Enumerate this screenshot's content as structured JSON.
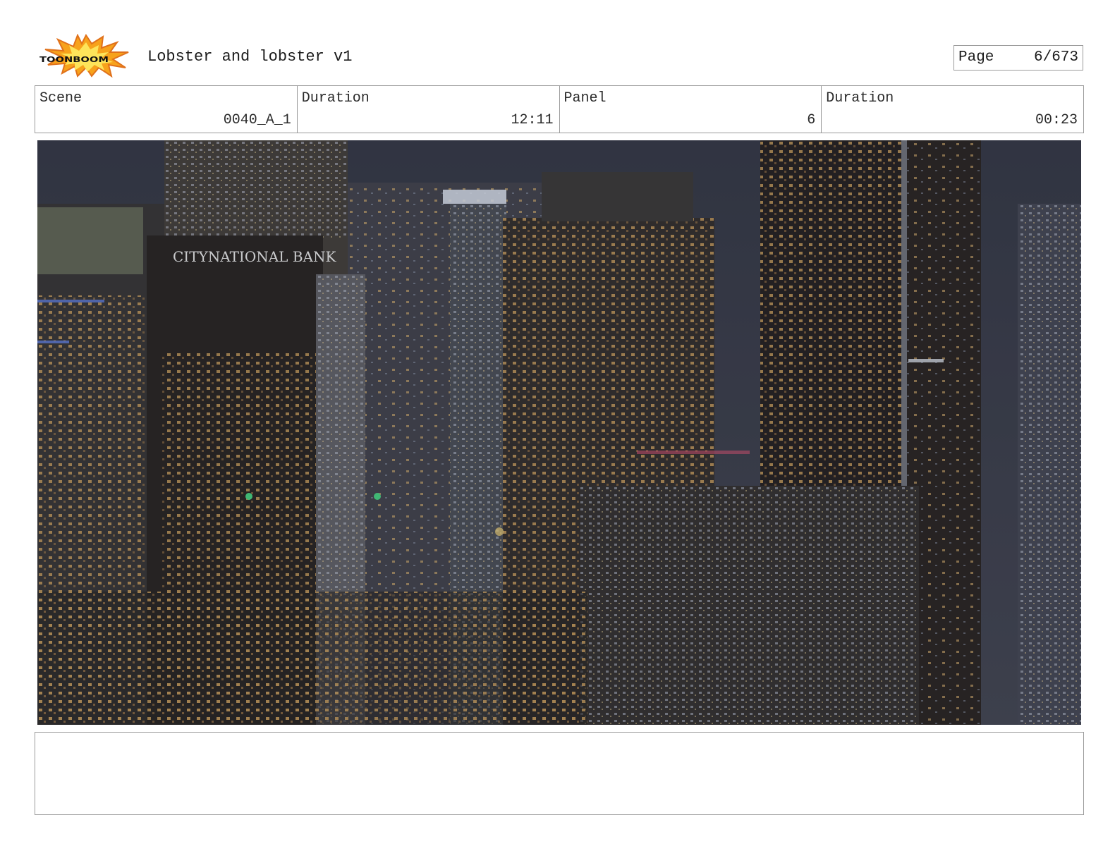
{
  "header": {
    "logo_text": "TOONBOOM",
    "title": "Lobster and lobster v1",
    "page_label": "Page",
    "page_value": "6/673"
  },
  "info": {
    "scene_label": "Scene",
    "scene_value": "0040_A_1",
    "scene_duration_label": "Duration",
    "scene_duration_value": "12:11",
    "panel_label": "Panel",
    "panel_value": "6",
    "panel_duration_label": "Duration",
    "panel_duration_value": "00:23"
  },
  "panel_image": {
    "description_icon": "night-city-skyline-image",
    "sign_text": "CITYNATIONAL BANK"
  },
  "notes": {
    "text": ""
  }
}
